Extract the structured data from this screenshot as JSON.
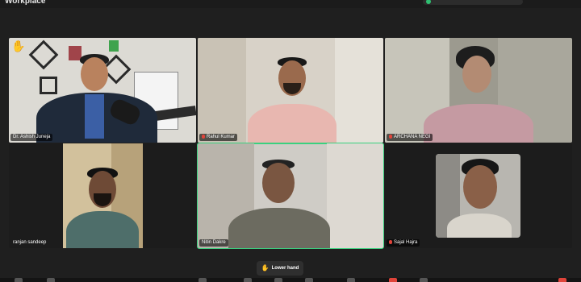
{
  "app": {
    "title": "Workplace",
    "status_text": ""
  },
  "reaction": {
    "raised_hand": "✋"
  },
  "participants": [
    {
      "name": "Dr. Ashish Juneja",
      "muted": false,
      "speaking": false
    },
    {
      "name": "Rahul Kumar",
      "muted": true,
      "speaking": false
    },
    {
      "name": "ARCHANA NEGI",
      "muted": true,
      "speaking": false
    },
    {
      "name": "ranjan sandeep",
      "muted": false,
      "speaking": false
    },
    {
      "name": "Nitin Dakre",
      "muted": false,
      "speaking": true
    },
    {
      "name": "Sajal Hajra",
      "muted": true,
      "speaking": false
    }
  ],
  "controls": {
    "lower_hand_label": "Lower hand",
    "hand_icon": "✋"
  },
  "colors": {
    "active_speaker": "#3ad17f",
    "muted_mic": "#e0443a",
    "hand": "#f2c744"
  }
}
